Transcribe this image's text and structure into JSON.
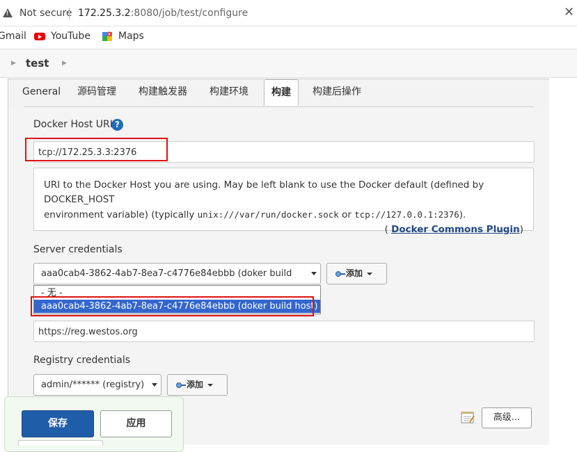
{
  "browser": {
    "security_label": "Not secure",
    "url_host": "172.25.3.2",
    "url_rest": ":8080/job/test/configure",
    "bookmarks": {
      "gmail": "Gmail",
      "youtube": "YouTube",
      "maps": "Maps"
    }
  },
  "breadcrumb": {
    "job_name": "test"
  },
  "tabs": [
    {
      "label": "General"
    },
    {
      "label": "源码管理"
    },
    {
      "label": "构建触发器"
    },
    {
      "label": "构建环境"
    },
    {
      "label": "构建"
    },
    {
      "label": "构建后操作"
    }
  ],
  "active_tab": "构建",
  "docker_host": {
    "label": "Docker Host URI",
    "help_icon_text": "?",
    "value": "tcp://172.25.3.3:2376",
    "help": {
      "line1": "URI to the Docker Host you are using. May be left blank to use the Docker default (defined by DOCKER_HOST",
      "line2_pre": "environment variable) (typically ",
      "code1": "unix:///var/run/docker.sock",
      "line2_mid": " or ",
      "code2": "tcp://127.0.0.1:2376",
      "line2_post": ").",
      "source_open": "( ",
      "source_link": "Docker Commons Plugin",
      "source_close": ")"
    }
  },
  "server_credentials": {
    "label": "Server credentials",
    "selected": "aaa0cab4-3862-4ab7-8ea7-c4776e84ebbb (doker build host)",
    "add_button": "添加",
    "options": [
      "- 无 -",
      "aaa0cab4-3862-4ab7-8ea7-c4776e84ebbb (doker build host)"
    ]
  },
  "registry_url": {
    "value": "https://reg.westos.org"
  },
  "registry_credentials": {
    "label": "Registry credentials",
    "selected": "admin/****** (registry)",
    "add_button": "添加"
  },
  "advanced_button": "高级...",
  "save_button": "保存",
  "apply_button": "应用",
  "colors": {
    "accent": "#1f5da8",
    "highlight_box": "#e01010",
    "dropdown_selected": "#3366cc"
  }
}
